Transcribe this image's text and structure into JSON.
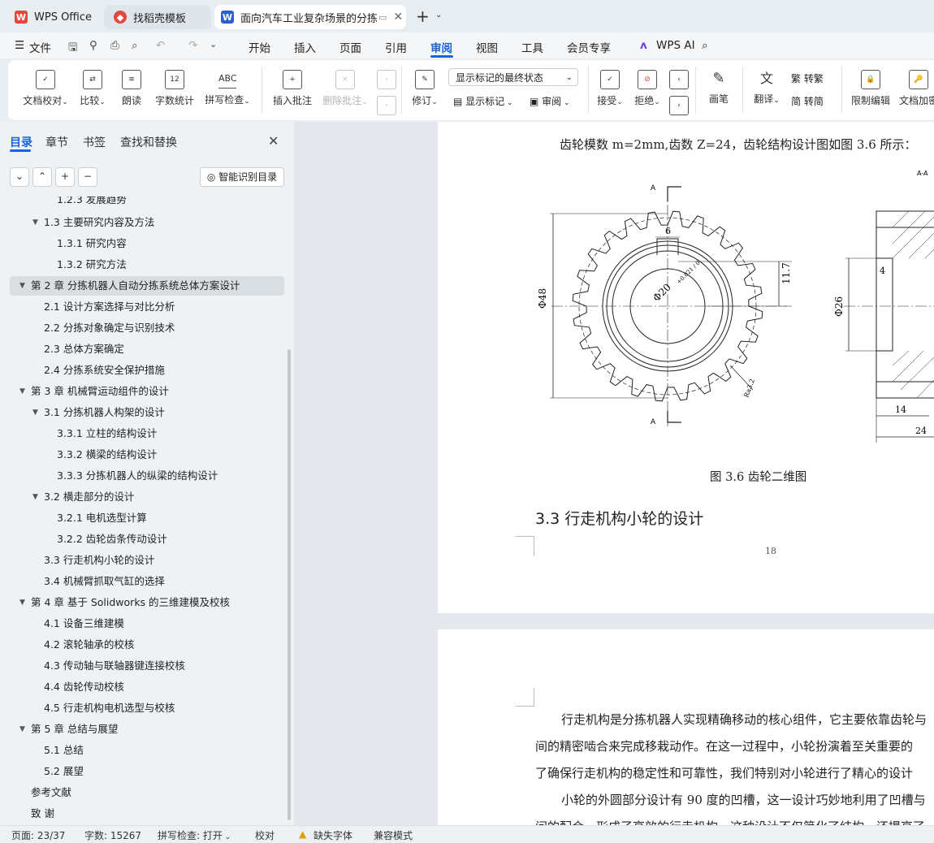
{
  "tabs": [
    {
      "label": "WPS Office"
    },
    {
      "label": "找稻壳模板"
    },
    {
      "label": "面向汽车工业复杂场景的分拣机"
    }
  ],
  "menu": {
    "file": "文件",
    "items": [
      "开始",
      "插入",
      "页面",
      "引用",
      "审阅",
      "视图",
      "工具",
      "会员专享"
    ],
    "active": "审阅",
    "wps_ai": "WPS AI"
  },
  "ribbon": {
    "doc_check": "文档校对",
    "compare": "比较",
    "read_aloud": "朗读",
    "word_count": "字数统计",
    "spell_check": "拼写检查",
    "insert_comment": "插入批注",
    "delete_comment": "删除批注",
    "revise": "修订",
    "markup_state": "显示标记的最终状态",
    "show_markup": "显示标记",
    "review": "审阅",
    "accept": "接受",
    "reject": "拒绝",
    "pen": "画笔",
    "translate": "翻译",
    "to_traditional": "转繁",
    "to_simplified": "转简",
    "restrict_edit": "限制编辑",
    "doc_encrypt": "文档加密",
    "word_count_icon_text": "12",
    "spell_icon_text": "ABC"
  },
  "panel": {
    "tabs": [
      "目录",
      "章节",
      "书签",
      "查找和替换"
    ],
    "smart_toc": "智能识别目录",
    "toc": [
      {
        "label": "1.2.3 发展趋势"
      },
      {
        "label": "1.3 主要研究内容及方法"
      },
      {
        "label": "1.3.1 研究内容"
      },
      {
        "label": "1.3.2 研究方法"
      },
      {
        "label": "第 2 章  分拣机器人自动分拣系统总体方案设计"
      },
      {
        "label": "2.1  设计方案选择与对比分析"
      },
      {
        "label": "2.2  分拣对象确定与识别技术"
      },
      {
        "label": "2.3  总体方案确定"
      },
      {
        "label": "2.4  分拣系统安全保护措施"
      },
      {
        "label": "第 3 章  机械臂运动组件的设计"
      },
      {
        "label": "3.1 分拣机器人构架的设计"
      },
      {
        "label": "3.3.1 立柱的结构设计"
      },
      {
        "label": "3.3.2 横梁的结构设计"
      },
      {
        "label": "3.3.3 分拣机器人的纵梁的结构设计"
      },
      {
        "label": "3.2  横走部分的设计"
      },
      {
        "label": "3.2.1 电机选型计算"
      },
      {
        "label": "3.2.2 齿轮齿条传动设计"
      },
      {
        "label": "3.3  行走机构小轮的设计"
      },
      {
        "label": "3.4  机械臂抓取气缸的选择"
      },
      {
        "label": "第 4 章  基于 Solidworks 的三维建模及校核"
      },
      {
        "label": "4.1  设备三维建模"
      },
      {
        "label": "4.2  滚轮轴承的校核"
      },
      {
        "label": "4.3 传动轴与联轴器键连接校核"
      },
      {
        "label": "4.4  齿轮传动校核"
      },
      {
        "label": "4.5  行走机构电机选型与校核"
      },
      {
        "label": "第 5 章  总结与展望"
      },
      {
        "label": "5.1  总结"
      },
      {
        "label": "5.2  展望"
      },
      {
        "label": "参考文献"
      },
      {
        "label": "致    谢"
      }
    ]
  },
  "document": {
    "intro": "齿轮模数 m=2mm,齿数 Z=24，齿轮结构设计图如图 3.6 所示：",
    "caption": "图 3.6 齿轮二维图",
    "heading": "3.3  行走机构小轮的设计",
    "page_number": "18",
    "para1_line1": "行走机构是分拣机器人实现精确移动的核心组件，它主要依靠齿轮与",
    "para1_line2": "间的精密啮合来完成移栽动作。在这一过程中，小轮扮演着至关重要的",
    "para1_line3": "了确保行走机构的稳定性和可靠性，我们特别对小轮进行了精心的设计",
    "para2_line1": "小轮的外圆部分设计有 90 度的凹槽，这一设计巧妙地利用了凹槽与",
    "para2_line2": "间的配合，形成了高效的行走机构。这种设计不仅简化了结构，还提高了",
    "drawing": {
      "dia48": "Φ48",
      "dia20": "Φ20",
      "tol": "+0.021 / 0",
      "dim6": "6",
      "dim117": "11.7",
      "ra32": "Ra3.2",
      "a_top": "A",
      "a_bot": "A",
      "section": "A-A",
      "dim4": "4",
      "dia26": "Φ26",
      "dim14": "14",
      "dim24": "24"
    }
  },
  "status": {
    "page": "页面: 23/37",
    "words": "字数: 15267",
    "spell": "拼写检查: 打开",
    "proof": "校对",
    "missing_font": "缺失字体",
    "compat": "兼容模式"
  },
  "colors": {
    "accent": "#1a63d8",
    "wps_red": "#e2463c"
  }
}
